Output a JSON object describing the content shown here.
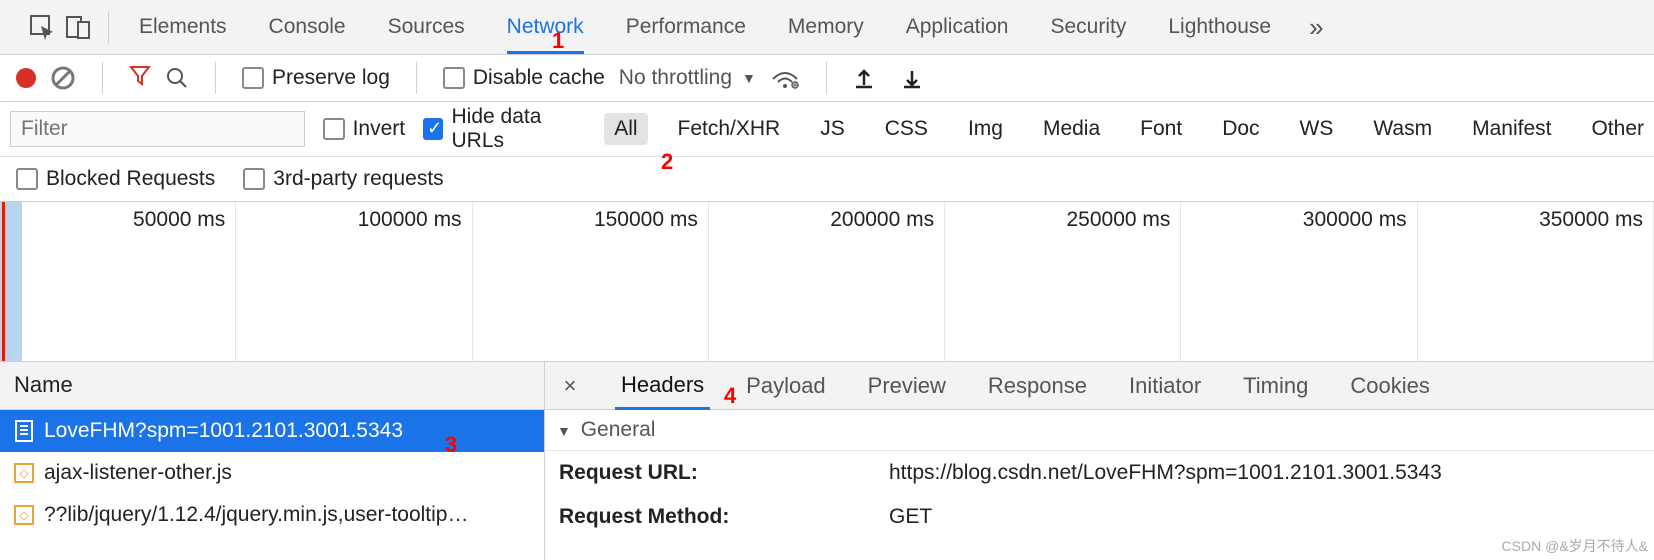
{
  "top_tabs": [
    "Elements",
    "Console",
    "Sources",
    "Network",
    "Performance",
    "Memory",
    "Application",
    "Security",
    "Lighthouse"
  ],
  "top_tab_active": "Network",
  "toolbar": {
    "preserve_log": "Preserve log",
    "disable_cache": "Disable cache",
    "throttling": "No throttling"
  },
  "filter": {
    "placeholder": "Filter",
    "invert": "Invert",
    "hide_data_urls": "Hide data URLs",
    "types": [
      "All",
      "Fetch/XHR",
      "JS",
      "CSS",
      "Img",
      "Media",
      "Font",
      "Doc",
      "WS",
      "Wasm",
      "Manifest",
      "Other"
    ],
    "type_active": "All",
    "blocked": "Blocked Requests",
    "third_party": "3rd-party requests"
  },
  "timeline_labels": [
    "50000 ms",
    "100000 ms",
    "150000 ms",
    "200000 ms",
    "250000 ms",
    "300000 ms",
    "350000 ms"
  ],
  "name_header": "Name",
  "requests": [
    {
      "name": "LoveFHM?spm=1001.2101.3001.5343",
      "type": "doc",
      "selected": true
    },
    {
      "name": "ajax-listener-other.js",
      "type": "js",
      "selected": false
    },
    {
      "name": "??lib/jquery/1.12.4/jquery.min.js,user-tooltip…",
      "type": "js",
      "selected": false
    }
  ],
  "detail_tabs": [
    "Headers",
    "Payload",
    "Preview",
    "Response",
    "Initiator",
    "Timing",
    "Cookies"
  ],
  "detail_tab_active": "Headers",
  "general": {
    "heading": "General",
    "request_url_k": "Request URL:",
    "request_url_v": "https://blog.csdn.net/LoveFHM?spm=1001.2101.3001.5343",
    "request_method_k": "Request Method:",
    "request_method_v": "GET"
  },
  "annotations": {
    "a1": "1",
    "a2": "2",
    "a3": "3",
    "a4": "4"
  },
  "watermark": "CSDN @&岁月不待人&"
}
